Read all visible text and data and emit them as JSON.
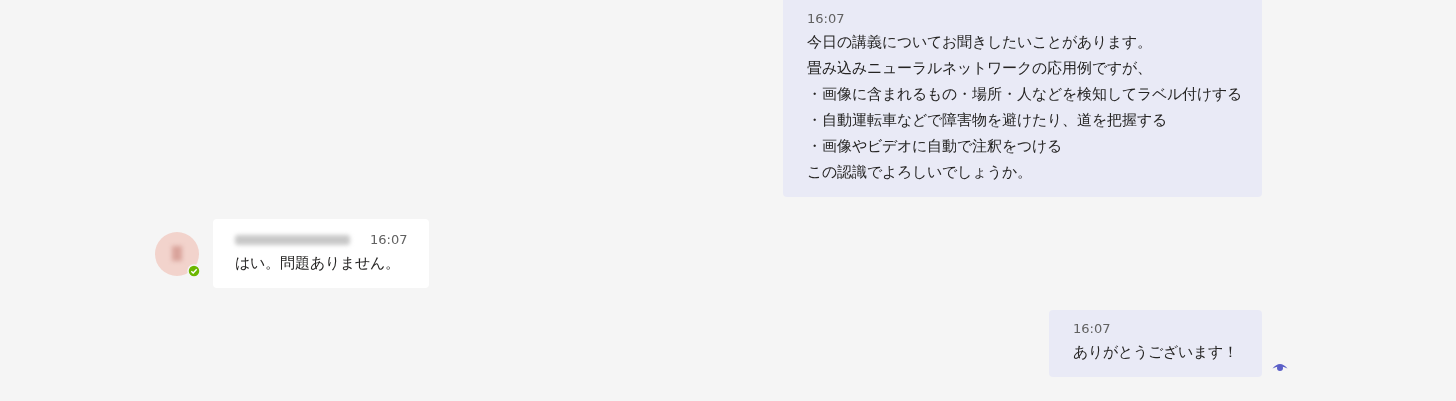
{
  "messages": [
    {
      "kind": "sent",
      "time": "16:07",
      "lines": [
        "今日の講義についてお聞きしたいことがあります。",
        "畳み込みニューラルネットワークの応用例ですが、",
        "・画像に含まれるもの・場所・人などを検知してラベル付けする",
        "・自動運転車などで障害物を避けたり、道を把握する",
        "・画像やビデオに自動で注釈をつける",
        "この認識でよろしいでしょうか。"
      ]
    },
    {
      "kind": "received",
      "time": "16:07",
      "lines": [
        "はい。問題ありません。"
      ],
      "online": true
    },
    {
      "kind": "sent",
      "time": "16:07",
      "lines": [
        "ありがとうございます！"
      ],
      "read": true
    }
  ]
}
